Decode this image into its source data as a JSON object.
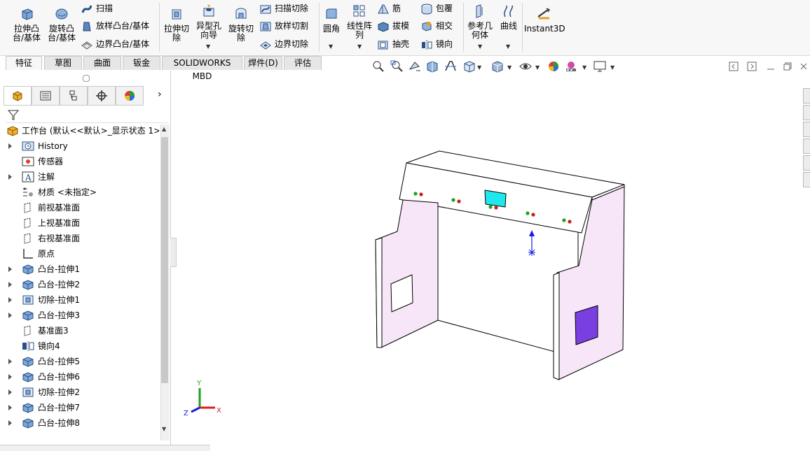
{
  "ribbon": {
    "extrude_boss": "拉伸凸\n台/基体",
    "revolve_boss": "旋转凸\n台/基体",
    "sweep": "扫描",
    "loft_boss": "放样凸台/基体",
    "boundary_boss": "边界凸台/基体",
    "extrude_cut": "拉伸切\n除",
    "hole_wizard": "异型孔\n向导",
    "revolve_cut": "旋转切\n除",
    "swept_cut": "扫描切除",
    "lofted_cut": "放样切割",
    "boundary_cut": "边界切除",
    "fillet": "圆角",
    "linear_pattern": "线性阵\n列",
    "rib": "筋",
    "wrap": "包覆",
    "draft": "拔模",
    "intersect": "相交",
    "shell": "抽壳",
    "mirror": "镜向",
    "ref_geometry": "参考几\n何体",
    "curves": "曲线",
    "instant3d": "Instant3D"
  },
  "tabs": [
    {
      "label": "特征",
      "active": true
    },
    {
      "label": "草图"
    },
    {
      "label": "曲面"
    },
    {
      "label": "钣金"
    },
    {
      "label": "SOLIDWORKS MBD"
    },
    {
      "label": "焊件(D)"
    },
    {
      "label": "评估"
    }
  ],
  "tree": {
    "root": "工作台 (默认<<默认>_显示状态 1>",
    "items": [
      {
        "label": "History",
        "icon": "history-icon",
        "exp": true
      },
      {
        "label": "传感器",
        "icon": "sensor-icon",
        "exp": false
      },
      {
        "label": "注解",
        "icon": "annotation-icon",
        "exp": true
      },
      {
        "label": "材质 <未指定>",
        "icon": "material-icon",
        "exp": false
      },
      {
        "label": "前视基准面",
        "icon": "plane-icon",
        "exp": false
      },
      {
        "label": "上视基准面",
        "icon": "plane-icon",
        "exp": false
      },
      {
        "label": "右视基准面",
        "icon": "plane-icon",
        "exp": false
      },
      {
        "label": "原点",
        "icon": "origin-icon",
        "exp": false
      },
      {
        "label": "凸台-拉伸1",
        "icon": "boss-icon",
        "exp": true
      },
      {
        "label": "凸台-拉伸2",
        "icon": "boss-icon",
        "exp": true
      },
      {
        "label": "切除-拉伸1",
        "icon": "cut-icon",
        "exp": true
      },
      {
        "label": "凸台-拉伸3",
        "icon": "boss-icon",
        "exp": true
      },
      {
        "label": "基准面3",
        "icon": "plane-icon",
        "exp": false
      },
      {
        "label": "镜向4",
        "icon": "mirror-icon",
        "exp": false
      },
      {
        "label": "凸台-拉伸5",
        "icon": "boss-icon",
        "exp": true
      },
      {
        "label": "凸台-拉伸6",
        "icon": "boss-icon",
        "exp": true
      },
      {
        "label": "切除-拉伸2",
        "icon": "cut-icon",
        "exp": true
      },
      {
        "label": "凸台-拉伸7",
        "icon": "boss-icon",
        "exp": true
      },
      {
        "label": "凸台-拉伸8",
        "icon": "boss-icon",
        "exp": true
      }
    ]
  },
  "triad": {
    "x": "X",
    "y": "Y",
    "z": "Z"
  },
  "colors": {
    "side_panel": "#f7e6f7",
    "cutout": "#7a3fe0",
    "screen": "#1ee8ec",
    "led_green": "#1aa31a",
    "led_red": "#c81e1e",
    "axis_blue": "#1a1ae0"
  }
}
